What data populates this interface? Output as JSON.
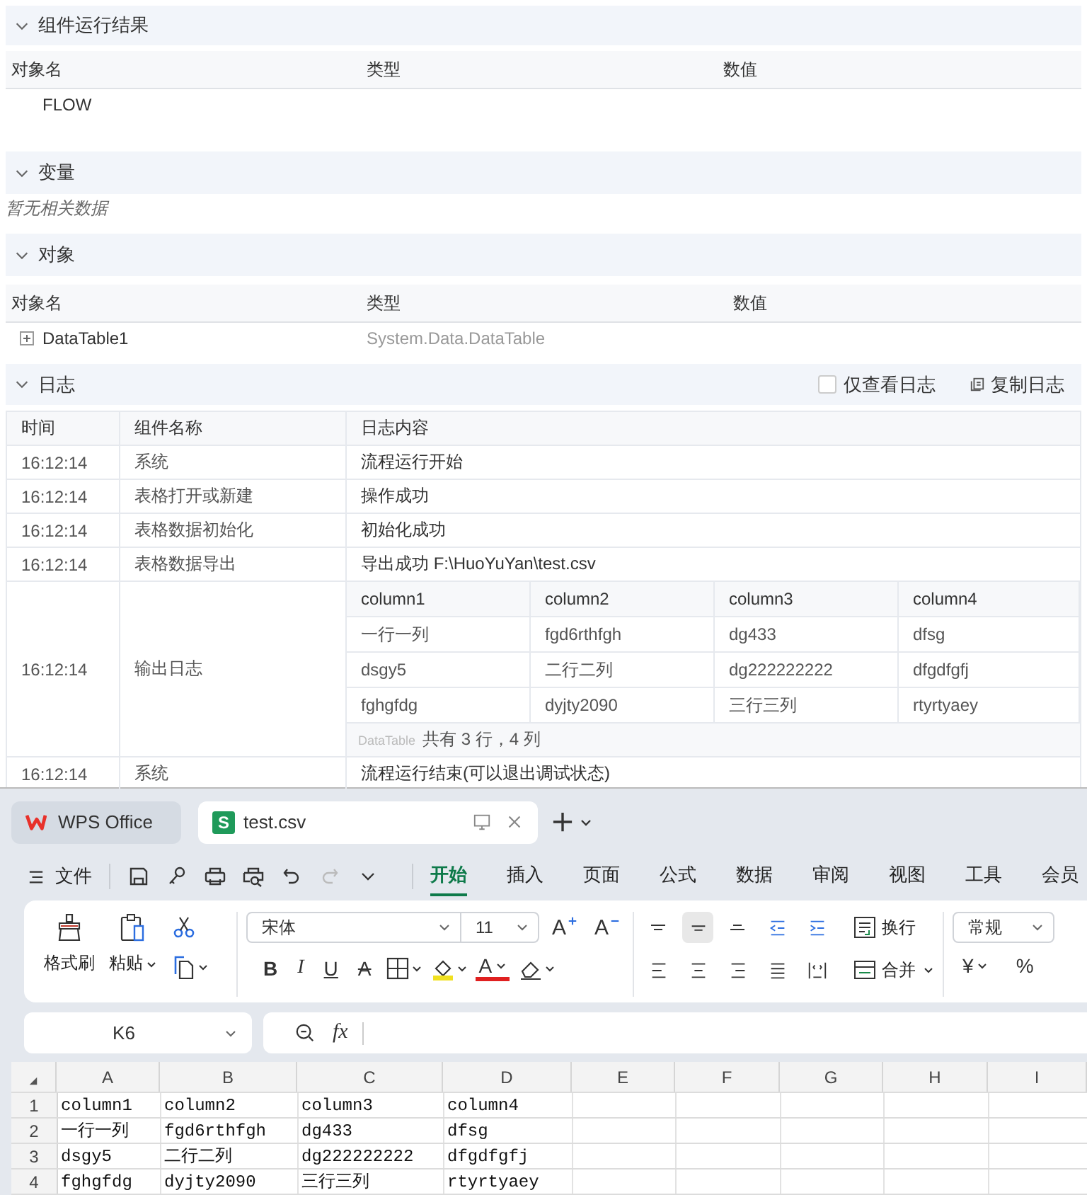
{
  "result_section": {
    "title": "组件运行结果",
    "expanded": true,
    "columns": [
      "对象名",
      "类型",
      "数值"
    ],
    "rows": [
      {
        "name": "FLOW"
      }
    ]
  },
  "variables_section": {
    "title": "变量",
    "expanded": true,
    "empty_text": "暂无相关数据"
  },
  "objects_section": {
    "title": "对象",
    "expanded": true,
    "columns": [
      "对象名",
      "类型",
      "数值"
    ],
    "rows": [
      {
        "name": "DataTable1",
        "type": "System.Data.DataTable",
        "expanded": false
      }
    ]
  },
  "log_section": {
    "title": "日志",
    "expanded": true,
    "only_log": {
      "label": "仅查看日志",
      "checked": false
    },
    "copy_button": "复制日志",
    "columns": [
      "时间",
      "组件名称",
      "日志内容"
    ],
    "rows": [
      {
        "kind": "text",
        "time": "16:12:14",
        "component": "系统",
        "content": "流程运行开始"
      },
      {
        "kind": "text",
        "time": "16:12:14",
        "component": "表格打开或新建",
        "content": "操作成功"
      },
      {
        "kind": "text",
        "time": "16:12:14",
        "component": "表格数据初始化",
        "content": "初始化成功"
      },
      {
        "kind": "text",
        "time": "16:12:14",
        "component": "表格数据导出",
        "content": "导出成功 F:\\HuoYuYan\\test.csv"
      },
      {
        "kind": "table",
        "time": "16:12:14",
        "component": "输出日志",
        "table": {
          "columns": [
            "column1",
            "column2",
            "column3",
            "column4"
          ],
          "rows": [
            [
              "一行一列",
              "fgd6rthfgh",
              "dg433",
              "dfsg"
            ],
            [
              "dsgy5",
              "二行二列",
              "dg222222222",
              "dfgdfgfj"
            ],
            [
              "fghgfdg",
              "dyjty2090",
              "三行三列",
              "rtyrtyaey"
            ]
          ],
          "tag": "DataTable",
          "summary": "共有 3 行，4 列"
        }
      },
      {
        "kind": "text",
        "time": "16:12:14",
        "component": "系统",
        "content": "流程运行结束(可以退出调试状态)"
      }
    ]
  },
  "wps": {
    "tabs": [
      {
        "kind": "home",
        "label": "WPS Office",
        "selected": false
      },
      {
        "kind": "sheet",
        "badge": "S",
        "label": "test.csv",
        "selected": true
      }
    ],
    "menu_label": "文件",
    "quick_tools": [
      {
        "kind": "save",
        "disabled": false
      },
      {
        "kind": "key",
        "disabled": false
      },
      {
        "kind": "print",
        "disabled": false
      },
      {
        "kind": "preview",
        "disabled": false
      },
      {
        "kind": "undo",
        "disabled": false
      },
      {
        "kind": "redo",
        "disabled": true
      },
      {
        "kind": "more",
        "disabled": false
      }
    ],
    "ribbon_tabs": [
      {
        "label": "开始",
        "selected": true
      },
      {
        "label": "插入",
        "selected": false
      },
      {
        "label": "页面",
        "selected": false
      },
      {
        "label": "公式",
        "selected": false
      },
      {
        "label": "数据",
        "selected": false
      },
      {
        "label": "审阅",
        "selected": false
      },
      {
        "label": "视图",
        "selected": false
      },
      {
        "label": "工具",
        "selected": false
      },
      {
        "label": "会员",
        "selected": false
      }
    ],
    "format_painter": "格式刷",
    "paste": "粘贴",
    "font_name": "宋体",
    "font_size": "11",
    "grow_font": "A",
    "shrink_font": "A",
    "style_buttons": [
      {
        "kind": "bold",
        "glyph": "B"
      },
      {
        "kind": "italic",
        "glyph": "I"
      },
      {
        "kind": "underline",
        "glyph": "U"
      },
      {
        "kind": "strike",
        "glyph": "A"
      }
    ],
    "font_color_glyph": "A",
    "align_top": [
      {
        "kind": "top",
        "selected": false
      },
      {
        "kind": "middle",
        "selected": true
      },
      {
        "kind": "bottom",
        "selected": false
      },
      {
        "kind": "outdent",
        "selected": false
      },
      {
        "kind": "indent",
        "selected": false
      }
    ],
    "align_bottom": [
      {
        "kind": "left",
        "selected": false
      },
      {
        "kind": "center",
        "selected": false
      },
      {
        "kind": "right",
        "selected": false
      },
      {
        "kind": "justify",
        "selected": false
      },
      {
        "kind": "distributed",
        "selected": false
      }
    ],
    "wrap_label": "换行",
    "merge_label": "合并",
    "number_format": "常规",
    "currency": "¥",
    "percent": "%",
    "name_box": "K6",
    "formula_label": "fx",
    "sheet": {
      "columns": [
        "A",
        "B",
        "C",
        "D",
        "E",
        "F",
        "G",
        "H",
        "I"
      ],
      "rows": [
        {
          "number": "1",
          "cells": [
            "column1",
            "column2",
            "column3",
            "column4"
          ]
        },
        {
          "number": "2",
          "cells": [
            "一行一列",
            "fgd6rthfgh",
            "dg433",
            "dfsg"
          ]
        },
        {
          "number": "3",
          "cells": [
            "dsgy5",
            "二行二列",
            "dg222222222",
            "dfgdfgfj"
          ]
        },
        {
          "number": "4",
          "cells": [
            "fghgfdg",
            "dyjty2090",
            "三行三列",
            "rtyrtyaey"
          ]
        }
      ]
    }
  }
}
